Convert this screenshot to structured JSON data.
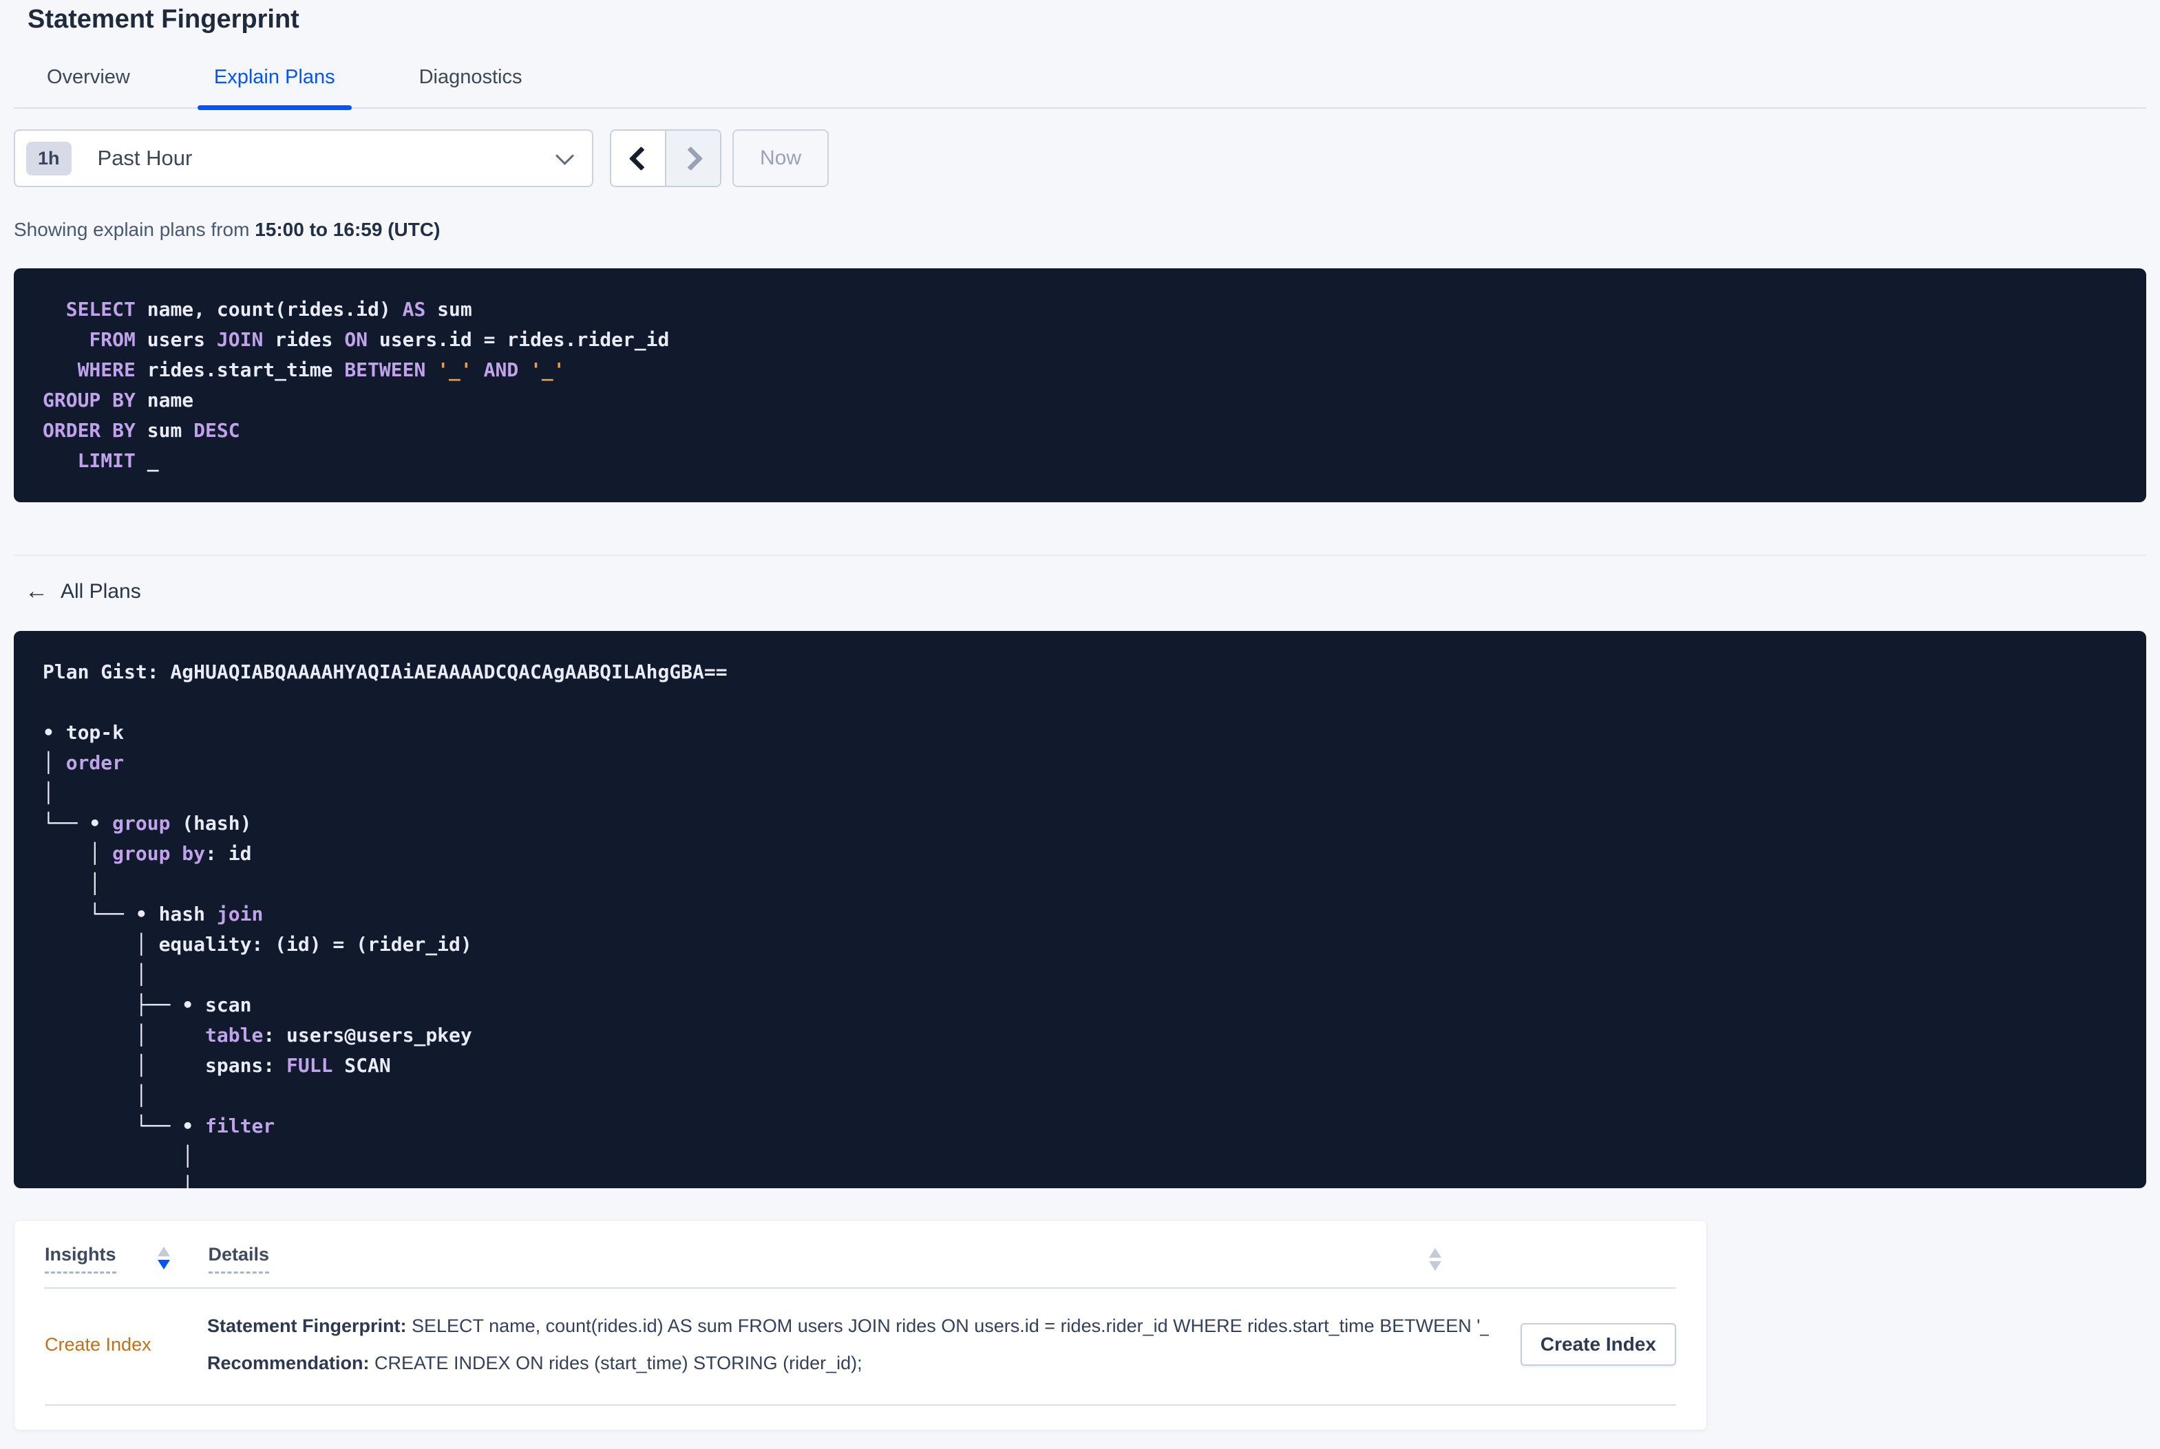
{
  "header": {
    "title": "Statement Fingerprint"
  },
  "tabs": {
    "items": [
      {
        "label": "Overview"
      },
      {
        "label": "Explain Plans"
      },
      {
        "label": "Diagnostics"
      }
    ],
    "active": "Explain Plans"
  },
  "toolbar": {
    "time_badge": "1h",
    "time_label": "Past Hour",
    "now_label": "Now"
  },
  "summary": {
    "prefix": "Showing explain plans from ",
    "bold_range": "15:00 to 16:59 (UTC)"
  },
  "sql": {
    "lines": [
      [
        {
          "t": "  "
        },
        {
          "t": "SELECT",
          "c": "kw"
        },
        {
          "t": " name, count(rides.id) "
        },
        {
          "t": "AS",
          "c": "kw"
        },
        {
          "t": " sum"
        }
      ],
      [
        {
          "t": "    "
        },
        {
          "t": "FROM",
          "c": "kw"
        },
        {
          "t": " users "
        },
        {
          "t": "JOIN",
          "c": "kw"
        },
        {
          "t": " rides "
        },
        {
          "t": "ON",
          "c": "kw"
        },
        {
          "t": " users.id = rides.rider_id"
        }
      ],
      [
        {
          "t": "   "
        },
        {
          "t": "WHERE",
          "c": "kw"
        },
        {
          "t": " rides.start_time "
        },
        {
          "t": "BETWEEN",
          "c": "kw"
        },
        {
          "t": " "
        },
        {
          "t": "'_'",
          "c": "lit"
        },
        {
          "t": " "
        },
        {
          "t": "AND",
          "c": "kw"
        },
        {
          "t": " "
        },
        {
          "t": "'_'",
          "c": "lit"
        }
      ],
      [
        {
          "t": "GROUP BY",
          "c": "kw"
        },
        {
          "t": " name"
        }
      ],
      [
        {
          "t": "ORDER BY",
          "c": "kw"
        },
        {
          "t": " sum "
        },
        {
          "t": "DESC",
          "c": "kw"
        }
      ],
      [
        {
          "t": "   "
        },
        {
          "t": "LIMIT",
          "c": "kw"
        },
        {
          "t": " _"
        }
      ]
    ]
  },
  "back_link": {
    "label": "All Plans"
  },
  "plan": {
    "gist": "AgHUAQIABQAAAAHYAQIAiAEAAAADCQACAgAABQILAhgGBA==",
    "lines": [
      [
        {
          "t": "Plan Gist: AgHUAQIABQAAAAHYAQIAiAEAAAADCQACAgAABQILAhgGBA=="
        }
      ],
      [],
      [
        {
          "t": "• top-k"
        }
      ],
      [
        {
          "t": "│ "
        },
        {
          "t": "order",
          "c": "kw"
        }
      ],
      [
        {
          "t": "│"
        }
      ],
      [
        {
          "t": "└── • "
        },
        {
          "t": "group",
          "c": "kw"
        },
        {
          "t": " (hash)"
        }
      ],
      [
        {
          "t": "    │ "
        },
        {
          "t": "group by",
          "c": "kw"
        },
        {
          "t": ": id"
        }
      ],
      [
        {
          "t": "    │"
        }
      ],
      [
        {
          "t": "    └── • hash "
        },
        {
          "t": "join",
          "c": "kw"
        }
      ],
      [
        {
          "t": "        │ equality: (id) = (rider_id)"
        }
      ],
      [
        {
          "t": "        │"
        }
      ],
      [
        {
          "t": "        ├── • scan"
        }
      ],
      [
        {
          "t": "        │     "
        },
        {
          "t": "table",
          "c": "kw"
        },
        {
          "t": ": users@users_pkey"
        }
      ],
      [
        {
          "t": "        │     spans: "
        },
        {
          "t": "FULL",
          "c": "kw"
        },
        {
          "t": " SCAN"
        }
      ],
      [
        {
          "t": "        │"
        }
      ],
      [
        {
          "t": "        └── • "
        },
        {
          "t": "filter",
          "c": "kw"
        }
      ],
      [
        {
          "t": "            │"
        }
      ],
      [
        {
          "t": "            │"
        }
      ]
    ]
  },
  "insights_table": {
    "col1_header": "Insights",
    "col2_header": "Details",
    "row": {
      "insight_label": "Create Index",
      "fingerprint_label": "Statement Fingerprint:",
      "fingerprint_text": " SELECT name, count(rides.id) AS sum FROM users JOIN rides ON users.id = rides.rider_id WHERE rides.start_time BETWEEN '_…",
      "recommendation_label": "Recommendation:",
      "recommendation_text": " CREATE INDEX ON rides (start_time) STORING (rider_id);",
      "action_button_label": "Create Index"
    }
  },
  "colors": {
    "accent_blue": "#0055ff",
    "code_background": "#111a2c",
    "code_keyword": "#c1a3ec",
    "code_literal": "#ee9d3a",
    "code_text": "#e9ecf6",
    "insight_orange": "#bf7215",
    "page_background": "#f5f7fa"
  }
}
